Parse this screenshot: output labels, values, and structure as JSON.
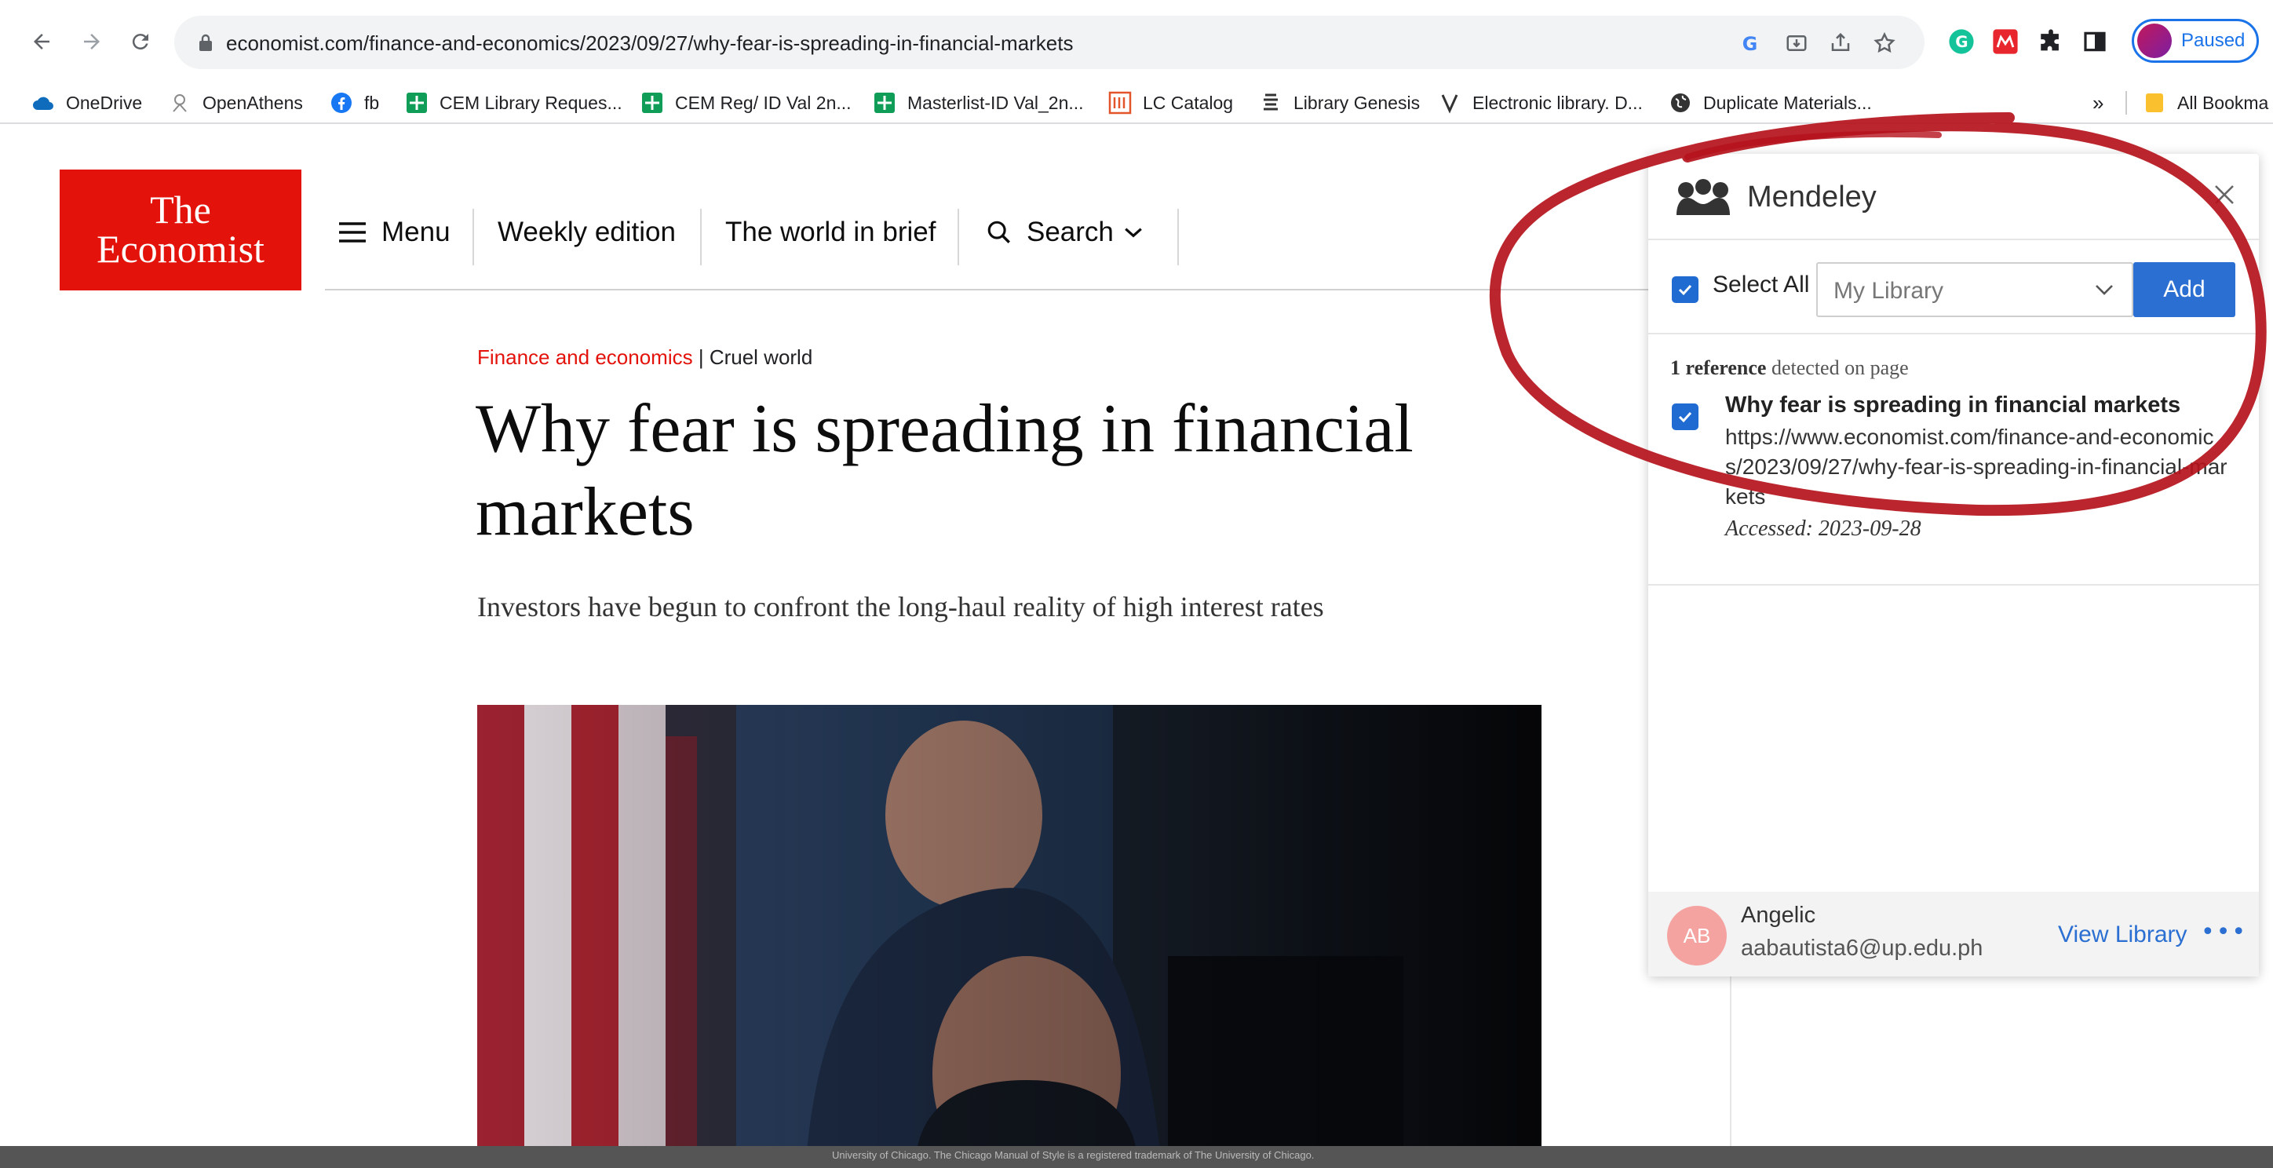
{
  "browser": {
    "url": "economist.com/finance-and-economics/2023/09/27/why-fear-is-spreading-in-financial-markets",
    "profile_status": "Paused",
    "bookmarks": [
      {
        "label": "OneDrive",
        "icon": "cloud-icon",
        "color": "#0f6cbd"
      },
      {
        "label": "OpenAthens",
        "icon": "openathens-icon",
        "color": "#8a8a8a"
      },
      {
        "label": "fb",
        "icon": "facebook-icon",
        "color": "#1877f2"
      },
      {
        "label": "CEM Library Reques...",
        "icon": "sheets-icon",
        "color": "#0f9d58"
      },
      {
        "label": "CEM Reg/ ID Val 2n...",
        "icon": "sheets-icon",
        "color": "#0f9d58"
      },
      {
        "label": "Masterlist-ID Val_2n...",
        "icon": "sheets-icon",
        "color": "#0f9d58"
      },
      {
        "label": "LC Catalog",
        "icon": "lc-icon",
        "color": "#e2552a"
      },
      {
        "label": "Library Genesis",
        "icon": "libgen-icon",
        "color": "#333333"
      },
      {
        "label": "Electronic library. D...",
        "icon": "zlib-icon",
        "color": "#333333"
      },
      {
        "label": "Duplicate Materials...",
        "icon": "globe-icon",
        "color": "#333333"
      }
    ],
    "overflow_label": "»",
    "all_bookmarks_label": "All Bookma"
  },
  "site": {
    "logo_line1": "The",
    "logo_line2": "Economist",
    "nav": {
      "menu": "Menu",
      "weekly": "Weekly edition",
      "brief": "The world in brief",
      "search": "Search"
    },
    "brand_color": "#e3120b"
  },
  "article": {
    "section": "Finance and economics",
    "separator": " | ",
    "topic": "Cruel world",
    "headline": "Why fear is spreading in financial markets",
    "standfirst": "Investors have begun to confront the long-haul reality of high interest rates"
  },
  "mendeley": {
    "title": "Mendeley",
    "select_all": "Select All",
    "library_value": "My Library",
    "add_label": "Add",
    "detected_count": "1 reference",
    "detected_text": " detected on page",
    "reference": {
      "title": "Why fear is spreading in financial markets",
      "url": "https://www.economist.com/finance-and-economics/2023/09/27/why-fear-is-spreading-in-financial-markets",
      "accessed": "Accessed: 2023-09-28"
    },
    "user": {
      "initials": "AB",
      "name": "Angelic",
      "email": "aabautista6@up.edu.ph"
    },
    "view_library": "View Library",
    "more": "•••"
  },
  "footer_text": "University of Chicago. The Chicago Manual of Style is a registered trademark of The University of Chicago."
}
